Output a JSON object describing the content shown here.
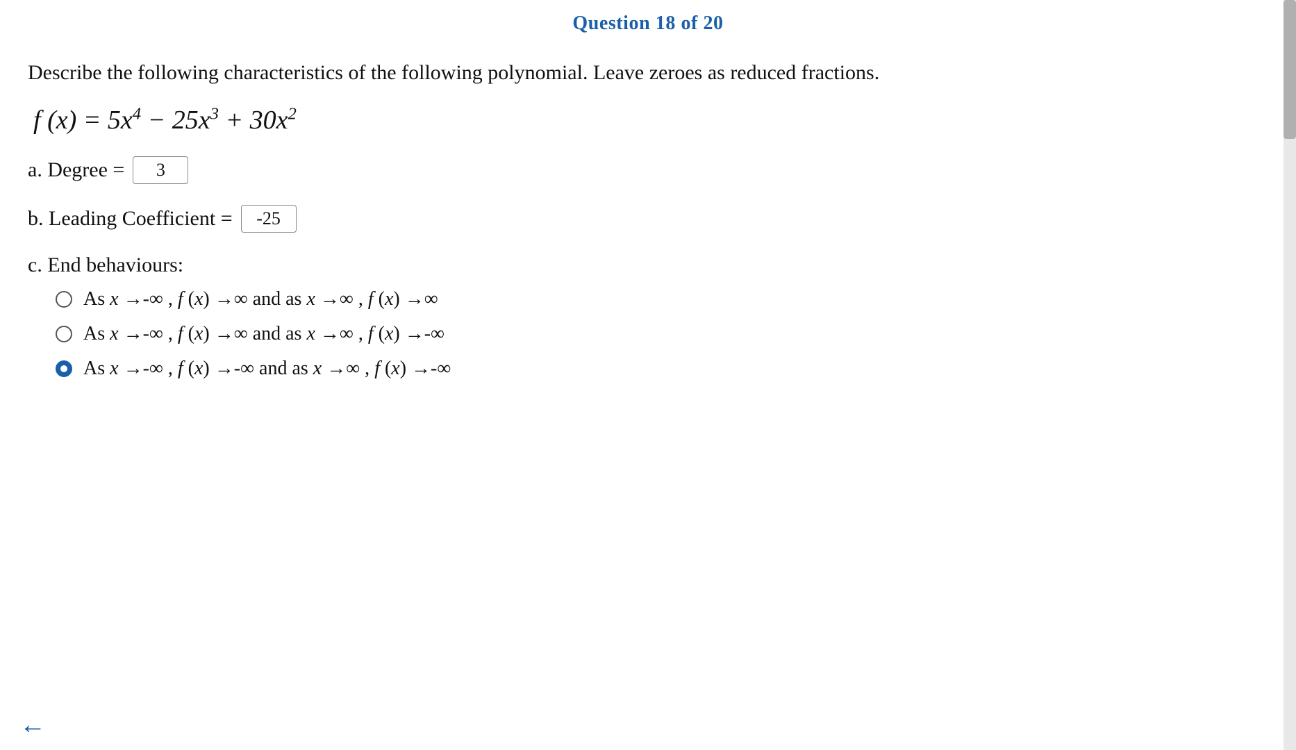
{
  "header": {
    "text": "Question 18 of 20",
    "question_num": "18",
    "total": "20"
  },
  "question": {
    "description": "Describe the following characteristics of the following polynomial. Leave zeroes as reduced fractions.",
    "polynomial_display": "f (x) = 5x⁴ − 25x³ + 30x²"
  },
  "parts": {
    "a": {
      "label": "a. Degree =",
      "value": "3"
    },
    "b": {
      "label": "b. Leading Coefficient =",
      "value": "-25"
    },
    "c": {
      "label": "c. End behaviours:",
      "options": [
        {
          "id": "opt1",
          "text": "As x →-∞ , f (x) →∞ and as x →∞ , f (x) →∞",
          "selected": false
        },
        {
          "id": "opt2",
          "text": "As x →-∞ , f (x) →∞ and as x →∞ , f (x) →-∞",
          "selected": false
        },
        {
          "id": "opt3",
          "text": "As x →-∞ , f (x) →-∞ and as x →∞ , f (x) →-∞",
          "selected": true
        }
      ]
    }
  },
  "navigation": {
    "back_label": "←"
  }
}
